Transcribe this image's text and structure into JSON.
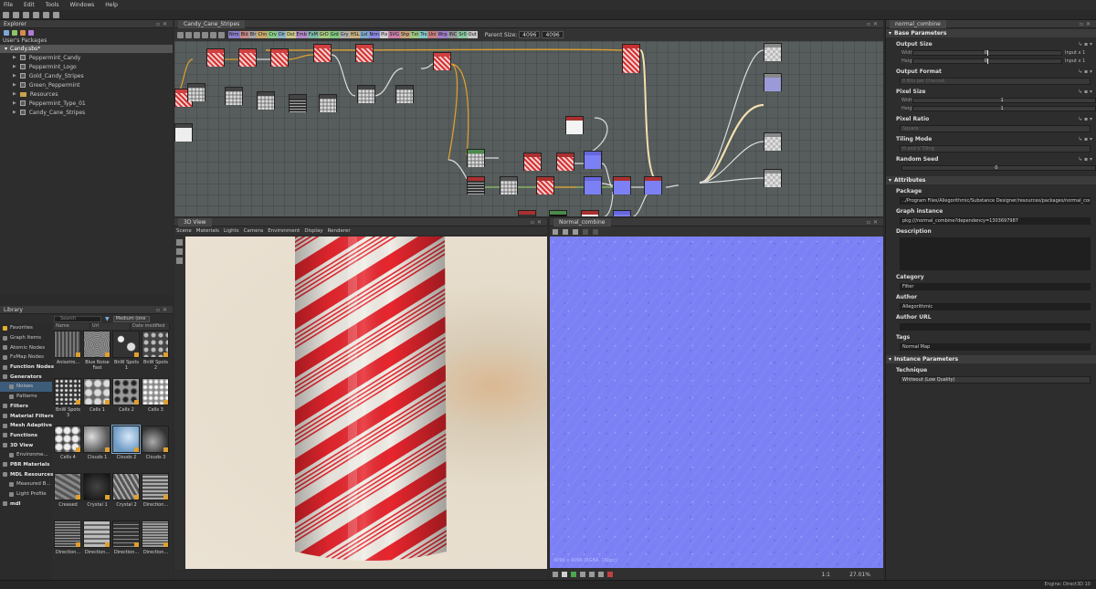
{
  "menu": [
    "File",
    "Edit",
    "Tools",
    "Windows",
    "Help"
  ],
  "explorer": {
    "title": "Explorer",
    "section_label": "User's Packages",
    "package": "Candy.sbs*",
    "items": [
      {
        "label": "Peppermint_Candy",
        "type": "graph"
      },
      {
        "label": "Peppermint_Logo",
        "type": "graph"
      },
      {
        "label": "Gold_Candy_Stripes",
        "type": "graph"
      },
      {
        "label": "Green_Peppermint",
        "type": "graph"
      },
      {
        "label": "Resources",
        "type": "folder"
      },
      {
        "label": "Peppermint_Type_01",
        "type": "graph"
      },
      {
        "label": "Candy_Cane_Stripes",
        "type": "graph"
      }
    ]
  },
  "library": {
    "title": "Library",
    "search_placeholder": "Search",
    "size_option": "Medium (one",
    "columns": [
      "Name",
      "Url",
      "Date modified"
    ],
    "categories": [
      {
        "label": "Favorites",
        "bold": false,
        "sub": false,
        "sel": false
      },
      {
        "label": "Graph Items",
        "bold": false,
        "sub": false,
        "sel": false
      },
      {
        "label": "Atomic Nodes",
        "bold": false,
        "sub": false,
        "sel": false
      },
      {
        "label": "FxMap Nodes",
        "bold": false,
        "sub": false,
        "sel": false
      },
      {
        "label": "Function Nodes",
        "bold": true,
        "sub": false,
        "sel": false
      },
      {
        "label": "Generators",
        "bold": true,
        "sub": false,
        "sel": false
      },
      {
        "label": "Noises",
        "bold": false,
        "sub": true,
        "sel": true
      },
      {
        "label": "Patterns",
        "bold": false,
        "sub": true,
        "sel": false
      },
      {
        "label": "Filters",
        "bold": true,
        "sub": false,
        "sel": false
      },
      {
        "label": "Material Filters",
        "bold": true,
        "sub": false,
        "sel": false
      },
      {
        "label": "Mesh Adaptive",
        "bold": true,
        "sub": false,
        "sel": false
      },
      {
        "label": "Functions",
        "bold": true,
        "sub": false,
        "sel": false
      },
      {
        "label": "3D View",
        "bold": true,
        "sub": false,
        "sel": false
      },
      {
        "label": "Environme...",
        "bold": false,
        "sub": true,
        "sel": false
      },
      {
        "label": "PBR Materials",
        "bold": true,
        "sub": false,
        "sel": false
      },
      {
        "label": "MDL Resources",
        "bold": true,
        "sub": false,
        "sel": false
      },
      {
        "label": "Measured B...",
        "bold": false,
        "sub": true,
        "sel": false
      },
      {
        "label": "Light Profile",
        "bold": false,
        "sub": true,
        "sel": false
      },
      {
        "label": "mdl",
        "bold": true,
        "sub": false,
        "sel": false
      }
    ],
    "tiles": [
      {
        "label": "Anisotro...",
        "tex": "aniso"
      },
      {
        "label": "Blue Noise Fast",
        "tex": "blue"
      },
      {
        "label": "BnW Spots 1",
        "tex": "spots"
      },
      {
        "label": "BnW Spots 2",
        "tex": "spots2"
      },
      {
        "label": "BnW Spots 3",
        "tex": "spots3"
      },
      {
        "label": "Cells 1",
        "tex": "cells"
      },
      {
        "label": "Cells 2",
        "tex": "cells2"
      },
      {
        "label": "Cells 3",
        "tex": "cells3"
      },
      {
        "label": "Cells 4",
        "tex": "cells4"
      },
      {
        "label": "Clouds 1",
        "tex": "clouds"
      },
      {
        "label": "Clouds 2",
        "tex": "clouds2"
      },
      {
        "label": "Clouds 3",
        "tex": "clouds3"
      },
      {
        "label": "Creased",
        "tex": "creased"
      },
      {
        "label": "Crystal 1",
        "tex": "crystal"
      },
      {
        "label": "Crystal 2",
        "tex": "crystal2"
      },
      {
        "label": "Direction...",
        "tex": "dir"
      },
      {
        "label": "Direction...",
        "tex": "dir2"
      },
      {
        "label": "Direction...",
        "tex": "dir3"
      },
      {
        "label": "Direction...",
        "tex": "dir4"
      },
      {
        "label": "Direction...",
        "tex": "dir5"
      }
    ]
  },
  "graph": {
    "tab": "Candy_Cane_Stripes",
    "parent_size_label": "Parent Size:",
    "parent_size_value": "4096",
    "size_value": "4096",
    "chips": [
      {
        "label": "Nrm",
        "color": "#8a7fc8"
      },
      {
        "label": "Bld",
        "color": "#c88a8a"
      },
      {
        "label": "Blr",
        "color": "#a5a5a5"
      },
      {
        "label": "Chn",
        "color": "#c8a86a"
      },
      {
        "label": "Crv",
        "color": "#8ac88a"
      },
      {
        "label": "Dir",
        "color": "#8ab4c8"
      },
      {
        "label": "Dst",
        "color": "#c8c88a"
      },
      {
        "label": "Emb",
        "color": "#b48ac8"
      },
      {
        "label": "FxM",
        "color": "#7fb8a8"
      },
      {
        "label": "GrD",
        "color": "#a8c87f"
      },
      {
        "label": "Grd",
        "color": "#7fc87f"
      },
      {
        "label": "Gry",
        "color": "#b0b0b0"
      },
      {
        "label": "HSL",
        "color": "#c8b07f"
      },
      {
        "label": "Lvl",
        "color": "#7fa8c8"
      },
      {
        "label": "Nrm",
        "color": "#8a8ae0"
      },
      {
        "label": "Pix",
        "color": "#d0d0d0"
      },
      {
        "label": "SVG",
        "color": "#c87fa8"
      },
      {
        "label": "Shp",
        "color": "#c8a07f"
      },
      {
        "label": "Txt",
        "color": "#a0c87f"
      },
      {
        "label": "Trs",
        "color": "#7fc8c8"
      },
      {
        "label": "Uni",
        "color": "#c87f7f"
      },
      {
        "label": "Wrp",
        "color": "#a07fc8"
      },
      {
        "label": "INC",
        "color": "#9a9a9a"
      },
      {
        "label": "Sr0",
        "color": "#8ac8a0"
      },
      {
        "label": "Out",
        "color": "#c8c8c8"
      }
    ]
  },
  "view3d": {
    "title": "3D View",
    "menu": [
      "Scene",
      "Materials",
      "Lights",
      "Camera",
      "Environment",
      "Display",
      "Renderer"
    ]
  },
  "view2d": {
    "title": "Normal_combine",
    "info": "4096 x 4096 (RGBA, 16bpc)",
    "zoom": "27.01%",
    "zoom_ratio": "1:1"
  },
  "props": {
    "title": "normal_combine",
    "base_section": "Base Parameters",
    "output_size": {
      "label": "Output Size",
      "width_key": "Width",
      "height_key": "Height",
      "width_value": "Input x 1",
      "height_value": "Input x 1",
      "zero": "0"
    },
    "output_format": {
      "label": "Output Format",
      "value": "8 Bits per Channel"
    },
    "pixel_size": {
      "label": "Pixel Size",
      "width_key": "Width",
      "height_key": "Height",
      "one": "1"
    },
    "pixel_ratio": {
      "label": "Pixel Ratio",
      "value": "Square"
    },
    "tiling_mode": {
      "label": "Tiling Mode",
      "value": "H and V Tiling"
    },
    "random_seed": {
      "label": "Random Seed",
      "value": "0"
    },
    "attributes_section": "Attributes",
    "package": {
      "label": "Package",
      "value": "../Program Files/Allegorithmic/Substance Designer/resources/packages/normal_combine.sbs"
    },
    "graph_instance": {
      "label": "Graph instance",
      "value": "pkg:///normal_combine?dependency=1303697987"
    },
    "description": {
      "label": "Description"
    },
    "category": {
      "label": "Category",
      "value": "Filter"
    },
    "author": {
      "label": "Author",
      "value": "Allegorithmic"
    },
    "author_url": {
      "label": "Author URL"
    },
    "tags": {
      "label": "Tags",
      "value": "Normal Map"
    },
    "instance_section": "Instance Parameters",
    "technique": {
      "label": "Technique",
      "value": "Whiteout (Low Quality)"
    }
  },
  "status": {
    "engine": "Engine: Direct3D 10"
  }
}
